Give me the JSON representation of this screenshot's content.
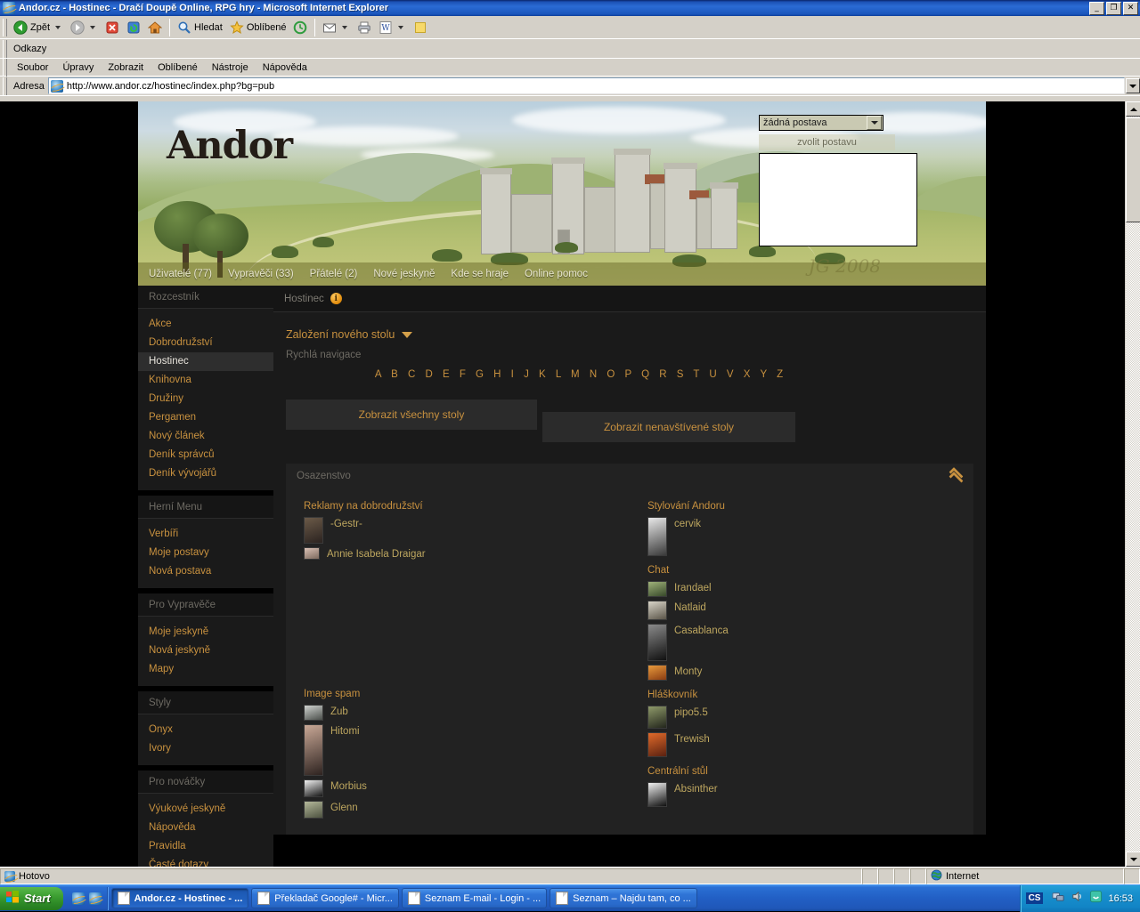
{
  "window": {
    "title": "Andor.cz - Hostinec - Dračí Doupě Online, RPG hry - Microsoft Internet Explorer",
    "minimize": "_",
    "maximize": "❐",
    "close": "✕"
  },
  "toolbar": {
    "back": "Zpět",
    "search": "Hledat",
    "favorites": "Oblíbené"
  },
  "links_bar": {
    "label": "Odkazy"
  },
  "menu_bar": {
    "items": [
      "Soubor",
      "Úpravy",
      "Zobrazit",
      "Oblíbené",
      "Nástroje",
      "Nápověda"
    ]
  },
  "address_bar": {
    "label": "Adresa",
    "url": "http://www.andor.cz/hostinec/index.php?bg=pub"
  },
  "site": {
    "logo": "Andor",
    "signature": "JG 2008",
    "banner_nav": [
      "Uživatelé (77)",
      "Vypravěči (33)",
      "Přátelé (2)",
      "Nové jeskyně",
      "Kde se hraje",
      "Online pomoc"
    ],
    "char_select": {
      "selected": "žádná postava",
      "button": "zvolit postavu"
    }
  },
  "sidebar": {
    "sections": [
      {
        "title": "Rozcestník",
        "items": [
          {
            "label": "Akce",
            "active": false
          },
          {
            "label": "Dobrodružství",
            "active": false
          },
          {
            "label": "Hostinec",
            "active": true
          },
          {
            "label": "Knihovna",
            "active": false
          },
          {
            "label": "Družiny",
            "active": false
          },
          {
            "label": "Pergamen",
            "active": false
          },
          {
            "label": "Nový článek",
            "active": false
          },
          {
            "label": "Deník správců",
            "active": false
          },
          {
            "label": "Deník vývojářů",
            "active": false
          }
        ]
      },
      {
        "title": "Herní Menu",
        "items": [
          {
            "label": "Verbíři",
            "active": false
          },
          {
            "label": "Moje postavy",
            "active": false
          },
          {
            "label": "Nová postava",
            "active": false
          }
        ]
      },
      {
        "title": "Pro Vypravěče",
        "items": [
          {
            "label": "Moje jeskyně",
            "active": false
          },
          {
            "label": "Nová jeskyně",
            "active": false
          },
          {
            "label": "Mapy",
            "active": false
          }
        ]
      },
      {
        "title": "Styly",
        "items": [
          {
            "label": "Onyx",
            "active": false
          },
          {
            "label": "Ivory",
            "active": false
          }
        ]
      },
      {
        "title": "Pro nováčky",
        "items": [
          {
            "label": "Výukové jeskyně",
            "active": false
          },
          {
            "label": "Nápověda",
            "active": false
          },
          {
            "label": "Pravidla",
            "active": false
          },
          {
            "label": "Časté dotazy",
            "active": false
          }
        ]
      }
    ]
  },
  "content": {
    "header_title": "Hostinec",
    "new_table_label": "Založení nového stolu",
    "quicknav_label": "Rychlá navigace",
    "alphabet": "A B C D E F G H I J K L M N O P Q R S T U V X Y Z",
    "show_all_tables": "Zobrazit všechny stoly",
    "show_unvisited_tables": "Zobrazit nenavštívené stoly",
    "occupancy": {
      "title": "Osazenstvo",
      "left_groups": [
        {
          "title": "Reklamy na dobrodružství",
          "users": [
            {
              "name": "-Gestr-",
              "avatar_w": 22,
              "avatar_h": 30,
              "c1": "#6b5a48",
              "c2": "#2b2320"
            },
            {
              "name": "Annie Isabela Draigar",
              "avatar_w": 18,
              "avatar_h": 14,
              "c1": "#d9c0b4",
              "c2": "#7d6a5e"
            }
          ]
        },
        {
          "title": "Image spam",
          "users": [
            {
              "name": "Zub",
              "avatar_w": 22,
              "avatar_h": 18,
              "c1": "#cfd2cf",
              "c2": "#4a4e4a"
            },
            {
              "name": "Hitomi",
              "avatar_w": 22,
              "avatar_h": 58,
              "c1": "#c9a896",
              "c2": "#2e2320"
            },
            {
              "name": "Morbius",
              "avatar_w": 22,
              "avatar_h": 20,
              "c1": "#f2f2f2",
              "c2": "#161616"
            },
            {
              "name": "Glenn",
              "avatar_w": 22,
              "avatar_h": 20,
              "c1": "#b4b89a",
              "c2": "#4d5240"
            }
          ]
        }
      ],
      "right_groups": [
        {
          "title": "Stylování Andoru",
          "users": [
            {
              "name": "cervik",
              "avatar_w": 22,
              "avatar_h": 44,
              "c1": "#e8e8e8",
              "c2": "#3a3a3a"
            }
          ]
        },
        {
          "title": "Chat",
          "users": [
            {
              "name": "Irandael",
              "avatar_w": 22,
              "avatar_h": 18,
              "c1": "#9fb27a",
              "c2": "#37482a"
            },
            {
              "name": "Natlaid",
              "avatar_w": 22,
              "avatar_h": 22,
              "c1": "#d8d4c8",
              "c2": "#5a5448"
            },
            {
              "name": "Casablanca",
              "avatar_w": 22,
              "avatar_h": 42,
              "c1": "#8a8a8a",
              "c2": "#111111"
            },
            {
              "name": "Monty",
              "avatar_w": 22,
              "avatar_h": 18,
              "c1": "#e89a3c",
              "c2": "#8a3c12"
            }
          ]
        },
        {
          "title": "Hláškovník",
          "users": [
            {
              "name": "pipo5.5",
              "avatar_w": 22,
              "avatar_h": 26,
              "c1": "#8f9a6a",
              "c2": "#23261c"
            },
            {
              "name": "Trewish",
              "avatar_w": 22,
              "avatar_h": 28,
              "c1": "#e06a2a",
              "c2": "#5a2110"
            }
          ]
        },
        {
          "title": "Centrální stůl",
          "users": [
            {
              "name": "Absinther",
              "avatar_w": 22,
              "avatar_h": 28,
              "c1": "#f0f0f0",
              "c2": "#101010"
            }
          ]
        }
      ]
    }
  },
  "statusbar": {
    "status": "Hotovo",
    "zone": "Internet"
  },
  "taskbar": {
    "start": "Start",
    "tasks": [
      {
        "label": "Andor.cz - Hostinec - ...",
        "active": true
      },
      {
        "label": "Překladač Google# - Micr...",
        "active": false
      },
      {
        "label": "Seznam E-mail - Login - ...",
        "active": false
      },
      {
        "label": "Seznam – Najdu tam, co ...",
        "active": false
      }
    ],
    "lang": "CS",
    "clock": "16:53"
  },
  "colors": {
    "accent": "#c8913f",
    "username": "#bda65f",
    "panel_bg": "#222222",
    "sidebar_bg": "#1a1a1a"
  }
}
